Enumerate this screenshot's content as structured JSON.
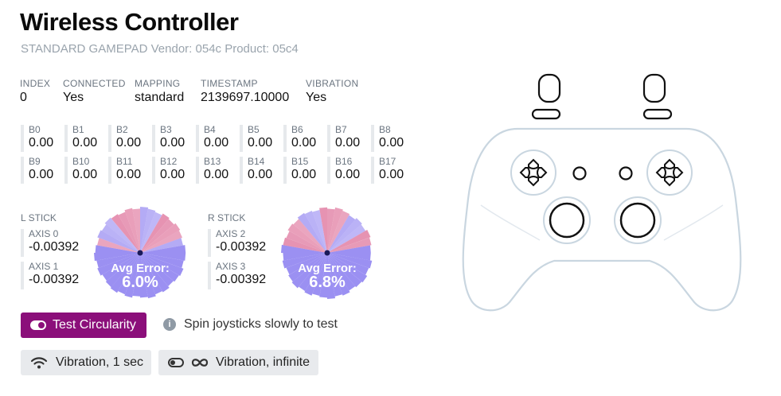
{
  "header": {
    "title": "Wireless Controller",
    "subtitle": "STANDARD GAMEPAD Vendor: 054c Product: 05c4"
  },
  "info": {
    "index": {
      "label": "INDEX",
      "value": "0"
    },
    "connected": {
      "label": "CONNECTED",
      "value": "Yes"
    },
    "mapping": {
      "label": "MAPPING",
      "value": "standard"
    },
    "timestamp": {
      "label": "TIMESTAMP",
      "value": "2139697.10000"
    },
    "vibration": {
      "label": "VIBRATION",
      "value": "Yes"
    }
  },
  "buttons": [
    {
      "label": "B0",
      "value": "0.00"
    },
    {
      "label": "B1",
      "value": "0.00"
    },
    {
      "label": "B2",
      "value": "0.00"
    },
    {
      "label": "B3",
      "value": "0.00"
    },
    {
      "label": "B4",
      "value": "0.00"
    },
    {
      "label": "B5",
      "value": "0.00"
    },
    {
      "label": "B6",
      "value": "0.00"
    },
    {
      "label": "B7",
      "value": "0.00"
    },
    {
      "label": "B8",
      "value": "0.00"
    },
    {
      "label": "B9",
      "value": "0.00"
    },
    {
      "label": "B10",
      "value": "0.00"
    },
    {
      "label": "B11",
      "value": "0.00"
    },
    {
      "label": "B12",
      "value": "0.00"
    },
    {
      "label": "B13",
      "value": "0.00"
    },
    {
      "label": "B14",
      "value": "0.00"
    },
    {
      "label": "B15",
      "value": "0.00"
    },
    {
      "label": "B16",
      "value": "0.00"
    },
    {
      "label": "B17",
      "value": "0.00"
    }
  ],
  "left_stick": {
    "label": "L STICK",
    "axis_x": {
      "label": "AXIS 0",
      "value": "-0.00392"
    },
    "axis_y": {
      "label": "AXIS 1",
      "value": "-0.00392"
    },
    "error_label": "Avg Error:",
    "error_value": "6.0%"
  },
  "right_stick": {
    "label": "R STICK",
    "axis_x": {
      "label": "AXIS 2",
      "value": "-0.00392"
    },
    "axis_y": {
      "label": "AXIS 3",
      "value": "-0.00392"
    },
    "error_label": "Avg Error:",
    "error_value": "6.8%"
  },
  "actions": {
    "test_circularity": "Test Circularity",
    "hint": "Spin joysticks slowly to test",
    "vibration_1sec": "Vibration, 1 sec",
    "vibration_infinite": "Vibration, infinite"
  },
  "colors": {
    "accent": "#8b0f7a",
    "circle_blue": "#8a7cf0",
    "circle_red": "#e07aa0",
    "controller_outline": "#c9d6e0"
  }
}
